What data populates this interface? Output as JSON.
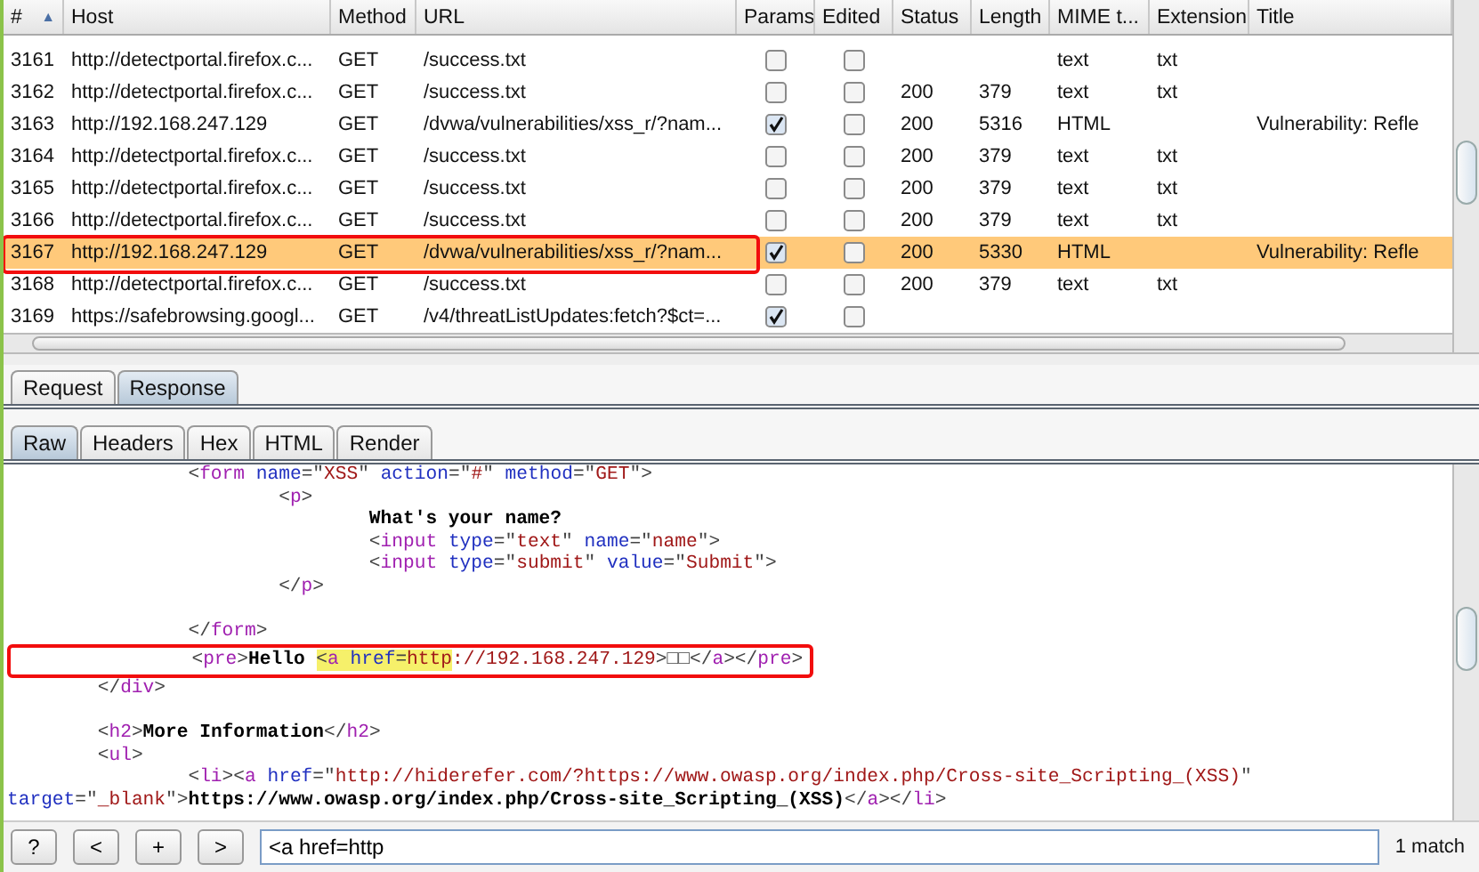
{
  "table": {
    "columns": [
      "#",
      "Host",
      "Method",
      "URL",
      "Params",
      "Edited",
      "Status",
      "Length",
      "MIME t...",
      "Extension",
      "Title"
    ],
    "sort_indicator": "▲",
    "rows": [
      {
        "num": "3161",
        "host": "http://detectportal.firefox.c...",
        "method": "GET",
        "url": "/success.txt",
        "params": false,
        "edited": false,
        "mime": "text",
        "extension": "txt",
        "selected": false,
        "boxed": false
      },
      {
        "num": "3162",
        "host": "http://detectportal.firefox.c...",
        "method": "GET",
        "url": "/success.txt",
        "params": false,
        "edited": false,
        "status": "200",
        "length": "379",
        "mime": "text",
        "extension": "txt",
        "selected": false,
        "boxed": false
      },
      {
        "num": "3163",
        "host": "http://192.168.247.129",
        "method": "GET",
        "url": "/dvwa/vulnerabilities/xss_r/?nam...",
        "params": true,
        "edited": false,
        "status": "200",
        "length": "5316",
        "mime": "HTML",
        "title": "Vulnerability: Refle",
        "selected": false,
        "boxed": false
      },
      {
        "num": "3164",
        "host": "http://detectportal.firefox.c...",
        "method": "GET",
        "url": "/success.txt",
        "params": false,
        "edited": false,
        "status": "200",
        "length": "379",
        "mime": "text",
        "extension": "txt",
        "selected": false,
        "boxed": false
      },
      {
        "num": "3165",
        "host": "http://detectportal.firefox.c...",
        "method": "GET",
        "url": "/success.txt",
        "params": false,
        "edited": false,
        "status": "200",
        "length": "379",
        "mime": "text",
        "extension": "txt",
        "selected": false,
        "boxed": false
      },
      {
        "num": "3166",
        "host": "http://detectportal.firefox.c...",
        "method": "GET",
        "url": "/success.txt",
        "params": false,
        "edited": false,
        "status": "200",
        "length": "379",
        "mime": "text",
        "extension": "txt",
        "selected": false,
        "boxed": false
      },
      {
        "num": "3167",
        "host": "http://192.168.247.129",
        "method": "GET",
        "url": "/dvwa/vulnerabilities/xss_r/?nam...",
        "params": true,
        "edited": false,
        "status": "200",
        "length": "5330",
        "mime": "HTML",
        "title": "Vulnerability: Refle",
        "selected": true,
        "boxed": true
      },
      {
        "num": "3168",
        "host": "http://detectportal.firefox.c...",
        "method": "GET",
        "url": "/success.txt",
        "params": false,
        "edited": false,
        "status": "200",
        "length": "379",
        "mime": "text",
        "extension": "txt",
        "selected": false,
        "boxed": false
      },
      {
        "num": "3169",
        "host": "https://safebrowsing.googl...",
        "method": "GET",
        "url": "/v4/threatListUpdates:fetch?$ct=...",
        "params": true,
        "edited": false,
        "selected": false,
        "boxed": false
      }
    ]
  },
  "message_tabs": [
    {
      "label": "Request",
      "selected": false
    },
    {
      "label": "Response",
      "selected": true
    }
  ],
  "view_tabs": [
    {
      "label": "Raw",
      "selected": true
    },
    {
      "label": "Headers",
      "selected": false
    },
    {
      "label": "Hex",
      "selected": false
    },
    {
      "label": "HTML",
      "selected": false
    },
    {
      "label": "Render",
      "selected": false
    }
  ],
  "code_lines": [
    {
      "boxed": false,
      "tokens": [
        {
          "kind": "punct",
          "text": "                <"
        },
        {
          "kind": "tag",
          "text": "form"
        },
        {
          "kind": "attr",
          "text": " name"
        },
        {
          "kind": "punct",
          "text": "=\""
        },
        {
          "kind": "value",
          "text": "XSS"
        },
        {
          "kind": "punct",
          "text": "\""
        },
        {
          "kind": "attr",
          "text": " action"
        },
        {
          "kind": "punct",
          "text": "=\""
        },
        {
          "kind": "value",
          "text": "#"
        },
        {
          "kind": "punct",
          "text": "\""
        },
        {
          "kind": "attr",
          "text": " method"
        },
        {
          "kind": "punct",
          "text": "=\""
        },
        {
          "kind": "value",
          "text": "GET"
        },
        {
          "kind": "punct",
          "text": "\">"
        }
      ]
    },
    {
      "boxed": false,
      "tokens": [
        {
          "kind": "punct",
          "text": "                        <"
        },
        {
          "kind": "tag",
          "text": "p"
        },
        {
          "kind": "punct",
          "text": ">"
        }
      ]
    },
    {
      "boxed": false,
      "tokens": [
        {
          "kind": "text",
          "text": "                                What's your name?"
        }
      ]
    },
    {
      "boxed": false,
      "tokens": [
        {
          "kind": "punct",
          "text": "                                <"
        },
        {
          "kind": "tag",
          "text": "input"
        },
        {
          "kind": "attr",
          "text": " type"
        },
        {
          "kind": "punct",
          "text": "=\""
        },
        {
          "kind": "value",
          "text": "text"
        },
        {
          "kind": "punct",
          "text": "\""
        },
        {
          "kind": "attr",
          "text": " name"
        },
        {
          "kind": "punct",
          "text": "=\""
        },
        {
          "kind": "value",
          "text": "name"
        },
        {
          "kind": "punct",
          "text": "\">"
        }
      ]
    },
    {
      "boxed": false,
      "tokens": [
        {
          "kind": "punct",
          "text": "                                <"
        },
        {
          "kind": "tag",
          "text": "input"
        },
        {
          "kind": "attr",
          "text": " type"
        },
        {
          "kind": "punct",
          "text": "=\""
        },
        {
          "kind": "value",
          "text": "submit"
        },
        {
          "kind": "punct",
          "text": "\""
        },
        {
          "kind": "attr",
          "text": " value"
        },
        {
          "kind": "punct",
          "text": "=\""
        },
        {
          "kind": "value",
          "text": "Submit"
        },
        {
          "kind": "punct",
          "text": "\">"
        }
      ]
    },
    {
      "boxed": false,
      "tokens": [
        {
          "kind": "punct",
          "text": "                        </"
        },
        {
          "kind": "tag",
          "text": "p"
        },
        {
          "kind": "punct",
          "text": ">"
        }
      ]
    },
    {
      "boxed": false
    },
    {
      "boxed": false,
      "tokens": [
        {
          "kind": "punct",
          "text": "                </"
        },
        {
          "kind": "tag",
          "text": "form"
        },
        {
          "kind": "punct",
          "text": ">"
        }
      ]
    },
    {
      "boxed": true,
      "tokens": [
        {
          "kind": "punct",
          "text": "                <"
        },
        {
          "kind": "tag",
          "text": "pre"
        },
        {
          "kind": "punct",
          "text": ">"
        },
        {
          "kind": "text",
          "text": "Hello "
        },
        {
          "kind": "punct",
          "text": "<",
          "match": true
        },
        {
          "kind": "tag",
          "text": "a",
          "match": true
        },
        {
          "kind": "attr",
          "text": " href",
          "match": true
        },
        {
          "kind": "punct",
          "text": "=",
          "match": true
        },
        {
          "kind": "value",
          "text": "http",
          "match": true
        },
        {
          "kind": "value",
          "text": "://192.168.247.129"
        },
        {
          "kind": "punct",
          "text": ">□□</"
        },
        {
          "kind": "tag",
          "text": "a"
        },
        {
          "kind": "punct",
          "text": "></"
        },
        {
          "kind": "tag",
          "text": "pre"
        },
        {
          "kind": "punct",
          "text": ">"
        }
      ]
    },
    {
      "boxed": false,
      "tokens": [
        {
          "kind": "punct",
          "text": "        </"
        },
        {
          "kind": "tag",
          "text": "div"
        },
        {
          "kind": "punct",
          "text": ">"
        }
      ]
    },
    {
      "boxed": false
    },
    {
      "boxed": false,
      "tokens": [
        {
          "kind": "punct",
          "text": "        <"
        },
        {
          "kind": "tag",
          "text": "h2"
        },
        {
          "kind": "punct",
          "text": ">"
        },
        {
          "kind": "text",
          "text": "More Information"
        },
        {
          "kind": "punct",
          "text": "</"
        },
        {
          "kind": "tag",
          "text": "h2"
        },
        {
          "kind": "punct",
          "text": ">"
        }
      ]
    },
    {
      "boxed": false,
      "tokens": [
        {
          "kind": "punct",
          "text": "        <"
        },
        {
          "kind": "tag",
          "text": "ul"
        },
        {
          "kind": "punct",
          "text": ">"
        }
      ]
    },
    {
      "boxed": false,
      "tokens": [
        {
          "kind": "punct",
          "text": "                <"
        },
        {
          "kind": "tag",
          "text": "li"
        },
        {
          "kind": "punct",
          "text": "><"
        },
        {
          "kind": "tag",
          "text": "a"
        },
        {
          "kind": "attr",
          "text": " href"
        },
        {
          "kind": "punct",
          "text": "=\""
        },
        {
          "kind": "value",
          "text": "http://hiderefer.com/?https://www.owasp.org/index.php/Cross-site_Scripting_(XSS)"
        },
        {
          "kind": "punct",
          "text": "\""
        }
      ]
    },
    {
      "boxed": false,
      "tokens": [
        {
          "kind": "attr",
          "text": "target"
        },
        {
          "kind": "punct",
          "text": "=\""
        },
        {
          "kind": "value",
          "text": "_blank"
        },
        {
          "kind": "punct",
          "text": "\">"
        },
        {
          "kind": "text",
          "text": "https://www.owasp.org/index.php/Cross-site_Scripting_(XSS)"
        },
        {
          "kind": "punct",
          "text": "</"
        },
        {
          "kind": "tag",
          "text": "a"
        },
        {
          "kind": "punct",
          "text": "></"
        },
        {
          "kind": "tag",
          "text": "li"
        },
        {
          "kind": "punct",
          "text": ">"
        }
      ]
    }
  ],
  "search_bar": {
    "buttons": [
      "?",
      "<",
      "+",
      ">"
    ],
    "value": "<a href=http",
    "result": "1 match"
  }
}
